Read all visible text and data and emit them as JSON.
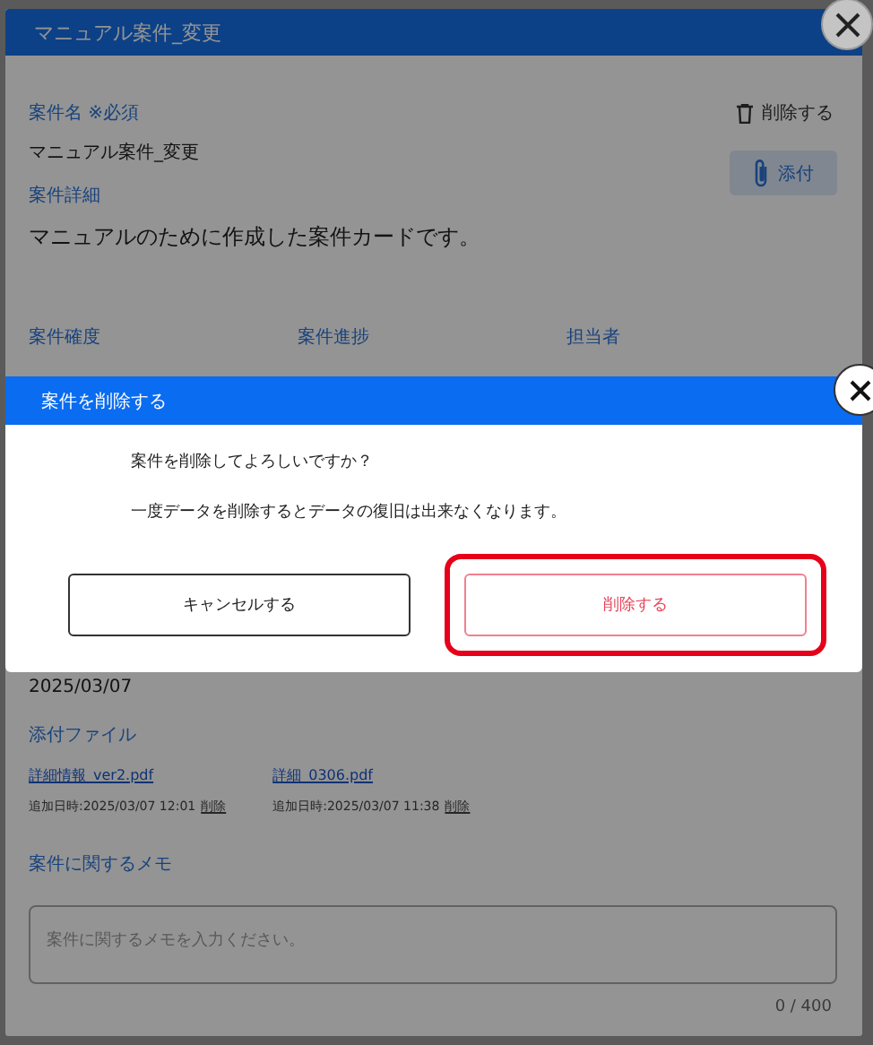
{
  "background_dialog": {
    "title": "マニュアル案件_変更",
    "fields": [
      {
        "label": "案件名 ※必須",
        "value": "マニュアル案件_変更"
      },
      {
        "label": "案件詳細",
        "value": "マニュアルのために作成した案件カードです。"
      }
    ],
    "delete_action": "削除する",
    "attach_button": "添付",
    "columns": [
      "案件確度",
      "案件進捗",
      "担当者"
    ],
    "date_value": "2025/03/07",
    "attachments_label": "添付ファイル",
    "attachments": [
      {
        "name": "詳細情報_ver2.pdf",
        "added": "追加日時:2025/03/07 12:01",
        "delete": "削除"
      },
      {
        "name": "詳細_0306.pdf",
        "added": "追加日時:2025/03/07 11:38",
        "delete": "削除"
      }
    ],
    "memo_label": "案件に関するメモ",
    "memo": {
      "placeholder": "案件に関するメモを入力ください。"
    },
    "memo_counter": "0 / 400"
  },
  "confirm_dialog": {
    "title": "案件を削除する",
    "messages": [
      "案件を削除してよろしいですか？",
      "一度データを削除するとデータの復旧は出来なくなります。"
    ],
    "buttons": [
      {
        "label": "キャンセルする",
        "kind": "cancel",
        "highlighted": false
      },
      {
        "label": "削除する",
        "kind": "delete",
        "highlighted": true
      }
    ]
  }
}
